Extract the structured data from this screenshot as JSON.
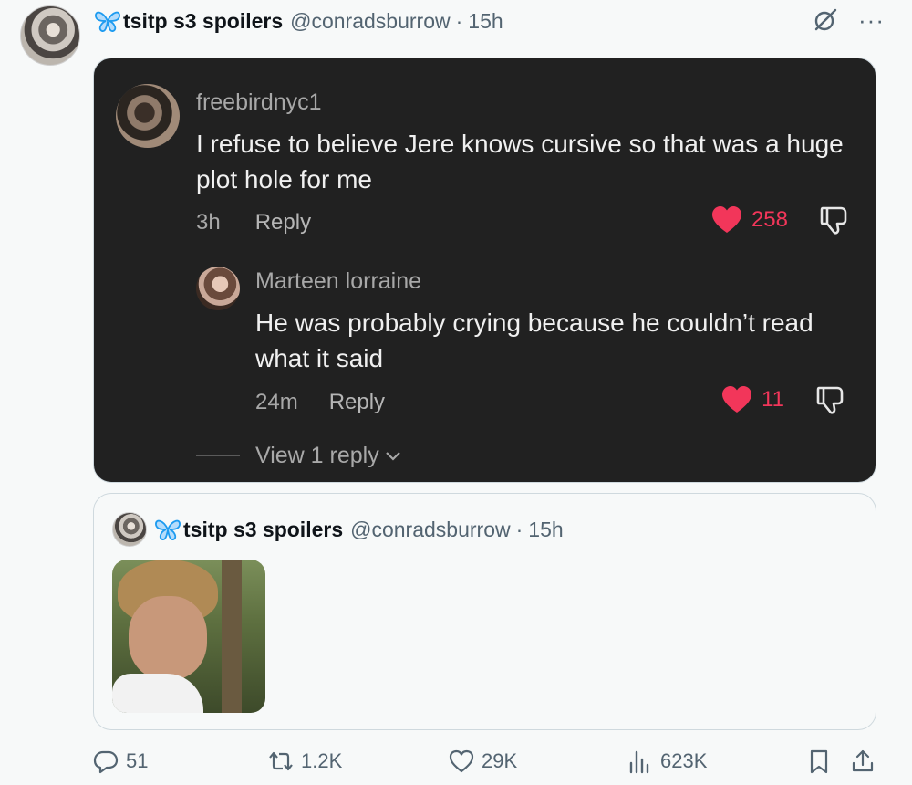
{
  "post": {
    "display_name": "tsitp s3 spoilers",
    "handle": "@conradsburrow",
    "separator": "·",
    "time": "15h",
    "more": "···"
  },
  "comment": {
    "username": "freebirdnyc1",
    "text": "I refuse to believe Jere knows cursive so that was a huge plot hole for me",
    "time": "3h",
    "reply_label": "Reply",
    "likes": "258"
  },
  "reply": {
    "username": "Marteen lorraine",
    "text": "He was probably crying because he couldn’t read what it said",
    "time": "24m",
    "reply_label": "Reply",
    "likes": "11"
  },
  "view_replies": "View 1 reply",
  "quote": {
    "display_name": "tsitp s3 spoilers",
    "handle": "@conradsburrow",
    "separator": "·",
    "time": "15h"
  },
  "actions": {
    "replies": "51",
    "reposts": "1.2K",
    "likes": "29K",
    "views": "623K"
  },
  "colors": {
    "heart": "#f2365a",
    "butterfly": "#1d9bf0",
    "card_bg": "#212121"
  }
}
